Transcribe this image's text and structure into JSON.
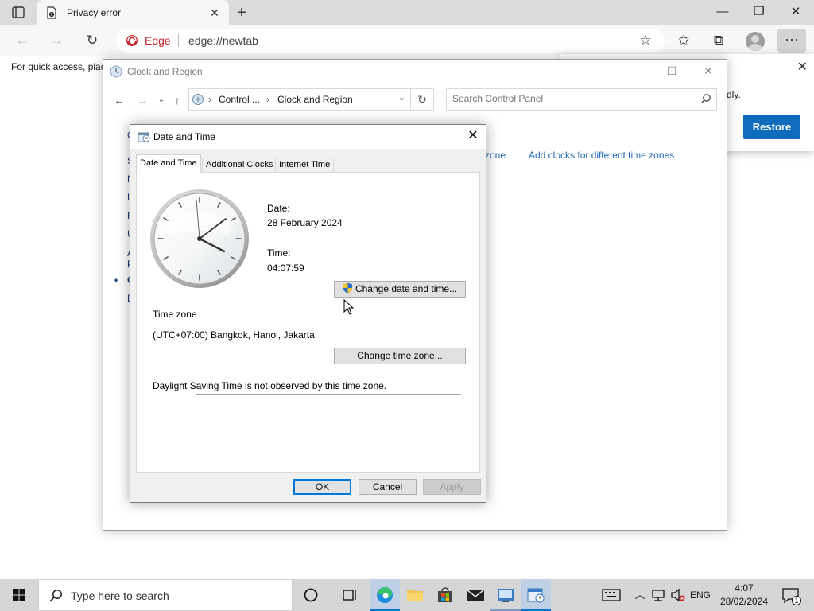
{
  "browser": {
    "tab_title": "Privacy error",
    "brand": "Edge",
    "url": "edge://newtab",
    "favbar_text": "For quick access, plac",
    "popup_text": "dly.",
    "restore_label": "Restore"
  },
  "control_panel": {
    "title": "Clock and Region",
    "breadcrumb": [
      "Control ...",
      "Clock and Region"
    ],
    "search_placeholder": "Search Control Panel",
    "link_partial": "e zone",
    "link_add_clocks": "Add clocks for different time zones",
    "left_letters": [
      "C",
      "S",
      "N",
      "H",
      "F",
      "U",
      "A",
      "P",
      "C",
      "E"
    ]
  },
  "dialog": {
    "title": "Date and Time",
    "tabs": [
      "Date and Time",
      "Additional Clocks",
      "Internet Time"
    ],
    "date_label": "Date:",
    "date_value": "28 February 2024",
    "time_label": "Time:",
    "time_value": "04:07:59",
    "change_date_btn": "Change date and time...",
    "timezone_label": "Time zone",
    "timezone_value": "(UTC+07:00) Bangkok, Hanoi, Jakarta",
    "change_tz_btn": "Change time zone...",
    "dst_text": "Daylight Saving Time is not observed by this time zone.",
    "ok": "OK",
    "cancel": "Cancel",
    "apply": "Apply"
  },
  "taskbar": {
    "search_placeholder": "Type here to search",
    "language": "ENG",
    "time": "4:07",
    "date": "28/02/2024",
    "notification_count": "1"
  },
  "colors": {
    "accent": "#0078d7",
    "edge_brand": "#c4262e",
    "restore_button": "#0f6cbd",
    "link": "#1a64b5"
  },
  "icons": [
    "tab-actions-icon",
    "shield-warning-icon",
    "close-icon",
    "plus-icon",
    "back-icon",
    "forward-icon",
    "refresh-icon",
    "edge-logo-icon",
    "add-favorite-icon",
    "favorites-icon",
    "collections-icon",
    "profile-icon",
    "more-icon",
    "clock-region-icon",
    "up-icon",
    "chevron-down-icon",
    "search-icon",
    "shield-uac-icon",
    "windows-start-icon",
    "cortana-icon",
    "task-view-icon",
    "edge-taskbar-icon",
    "file-explorer-icon",
    "store-icon",
    "mail-icon",
    "control-panel-icon",
    "date-time-icon",
    "keyboard-icon",
    "chevron-up-icon",
    "network-icon",
    "volume-muted-icon",
    "notification-icon"
  ]
}
